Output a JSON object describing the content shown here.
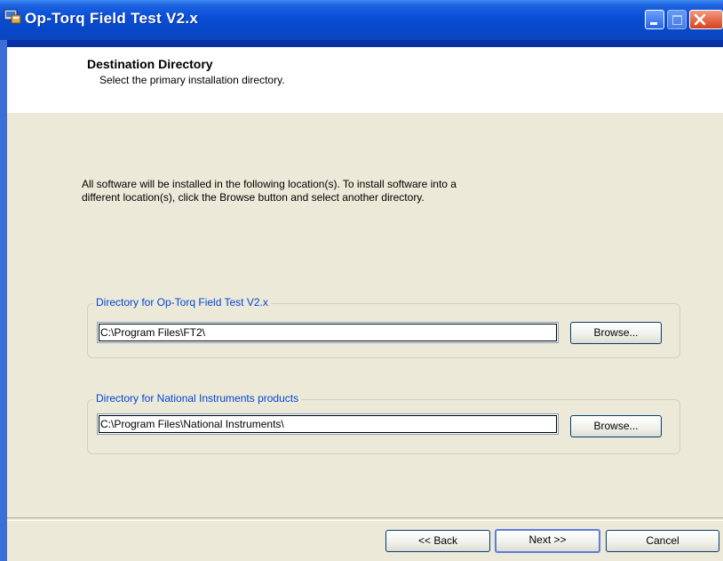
{
  "window": {
    "title": "Op-Torq Field Test V2.x"
  },
  "header": {
    "title": "Destination Directory",
    "subtitle": "Select the primary installation directory."
  },
  "body": {
    "intro_line1": "All software will be installed in the following location(s). To install software into a",
    "intro_line2": "different location(s), click the Browse button and select another directory."
  },
  "groups": [
    {
      "label": "Directory for Op-Torq Field Test V2.x",
      "value": "C:\\Program Files\\FT2\\",
      "browse_label": "Browse..."
    },
    {
      "label": "Directory for National Instruments products",
      "value": "C:\\Program Files\\National Instruments\\",
      "browse_label": "Browse..."
    }
  ],
  "footer": {
    "back_label": "<< Back",
    "next_label": "Next >>",
    "cancel_label": "Cancel"
  },
  "colors": {
    "titlebar": "#0a4fd8",
    "legend_text": "#0046d5",
    "face": "#ece9d8"
  }
}
